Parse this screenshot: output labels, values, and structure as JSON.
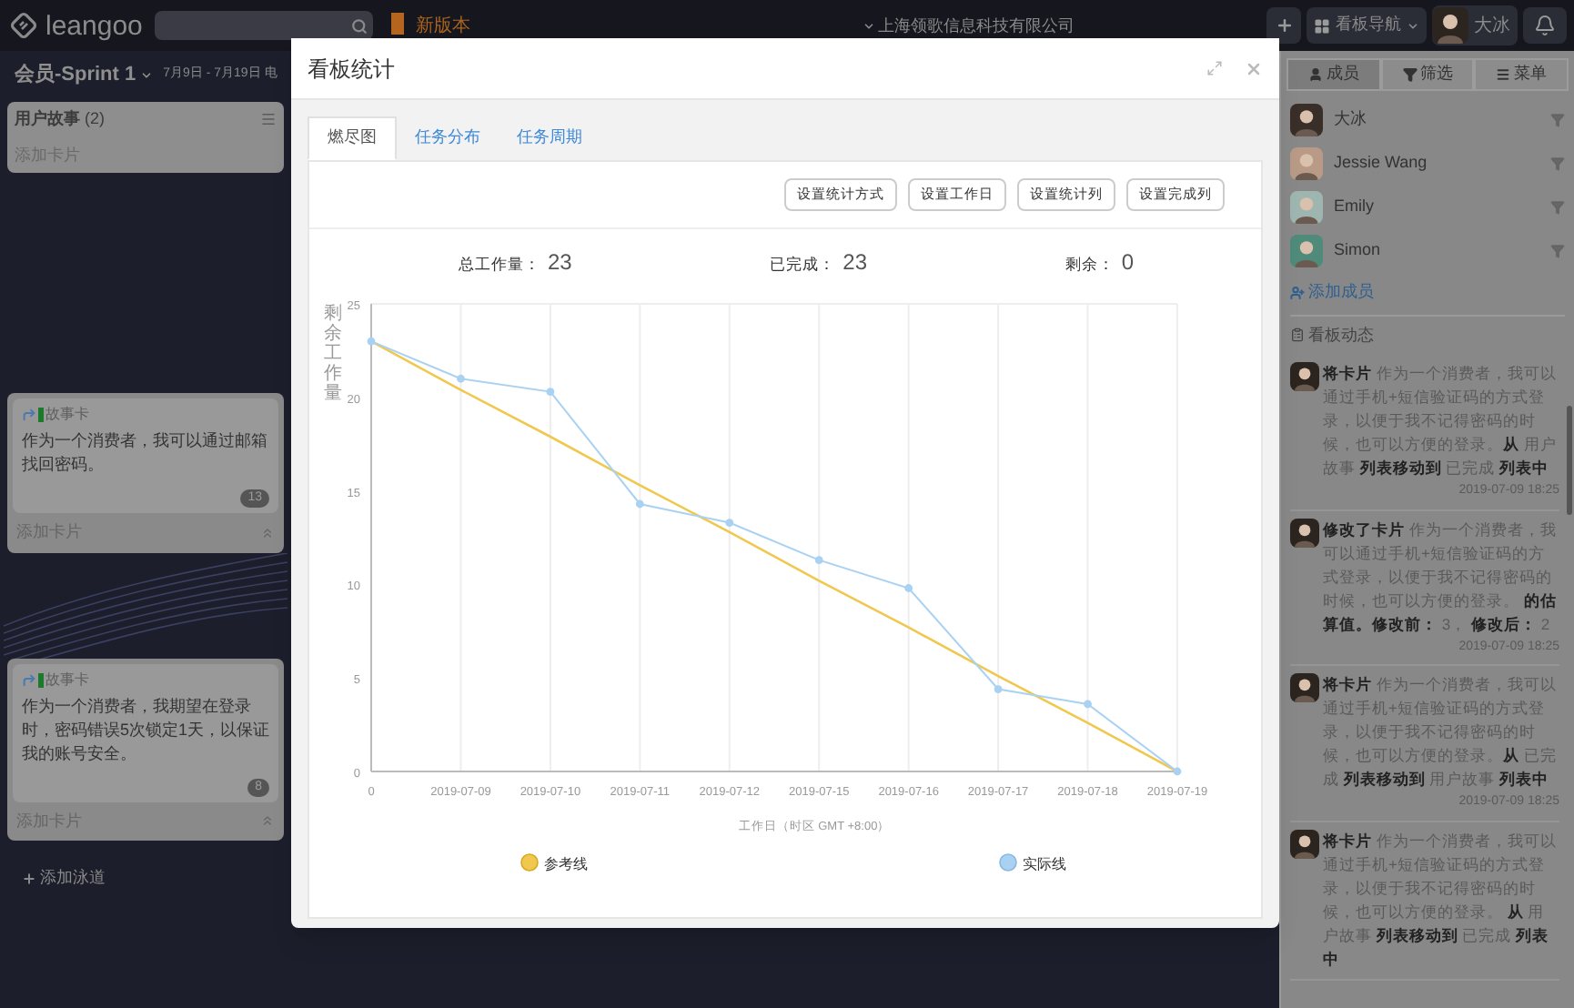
{
  "top_bar": {
    "logo": "leangoo",
    "new_version": "新版本",
    "company": "上海领歌信息科技有限公司",
    "nav_label": "看板导航",
    "user_name": "大冰"
  },
  "board": {
    "title": "会员-Sprint 1",
    "dates": "7月9日 - 7月19日 电",
    "list": {
      "name": "用户故事",
      "count": "(2)",
      "add_card": "添加卡片"
    },
    "lanes": [
      {
        "card": {
          "type": "故事卡",
          "text": "作为一个消费者，我可以通过邮箱找回密码。",
          "estimate": "13"
        },
        "add_card": "添加卡片"
      },
      {
        "card": {
          "type": "故事卡",
          "text": "作为一个消费者，我期望在登录时，密码错误5次锁定1天，以保证我的账号安全。",
          "estimate": "8"
        },
        "add_card": "添加卡片"
      }
    ],
    "add_lane": "添加泳道"
  },
  "right_panel": {
    "tabs": [
      {
        "label": "成员",
        "kind": "members",
        "selected": true
      },
      {
        "label": "筛选",
        "kind": "filter",
        "selected": false
      },
      {
        "label": "菜单",
        "kind": "menu",
        "selected": false
      }
    ],
    "members": [
      {
        "name": "大冰",
        "color": "#3a2e28"
      },
      {
        "name": "Jessie Wang",
        "color": "#b89a86"
      },
      {
        "name": "Emily",
        "color": "#9fb6b0"
      },
      {
        "name": "Simon",
        "color": "#4f8a7a"
      }
    ],
    "add_member": "添加成员",
    "activity_title": "看板动态",
    "activities": [
      {
        "text": "**将卡片** 作为一个消费者，我可以通过手机+短信验证码的方式登录，以便于我不记得密码的时候，也可以方便的登录。**从** 用户故事 **列表移动到** 已完成 **列表中**",
        "time": "2019-07-09 18:25"
      },
      {
        "text": "**修改了卡片** 作为一个消费者，我可以通过手机+短信验证码的方式登录，以便于我不记得密码的时候，也可以方便的登录。 **的估算值。修改前：** 3， **修改后：** 2",
        "time": "2019-07-09 18:25"
      },
      {
        "text": "**将卡片** 作为一个消费者，我可以通过手机+短信验证码的方式登录，以便于我不记得密码的时候，也可以方便的登录。**从** 已完成 **列表移动到** 用户故事 **列表中**",
        "time": "2019-07-09 18:25"
      },
      {
        "text": "**将卡片** 作为一个消费者，我可以通过手机+短信验证码的方式登录，以便于我不记得密码的时候，也可以方便的登录。 **从** 用户故事 **列表移动到** 已完成 **列表中**"
      }
    ]
  },
  "modal": {
    "title": "看板统计",
    "tabs": [
      {
        "label": "燃尽图",
        "selected": true
      },
      {
        "label": "任务分布",
        "selected": false
      },
      {
        "label": "任务周期",
        "selected": false
      }
    ],
    "buttons": [
      "设置统计方式",
      "设置工作日",
      "设置统计列",
      "设置完成列"
    ],
    "stats": [
      {
        "label": "总工作量：",
        "value": "23"
      },
      {
        "label": "已完成：",
        "value": "23"
      },
      {
        "label": "剩余：",
        "value": "0"
      }
    ],
    "chart_data": {
      "type": "line",
      "xlabel": "工作日（时区 GMT +8:00）",
      "ylabel": "剩余工作量",
      "grid": true,
      "legend": "bottom",
      "categories": [
        "0",
        "2019-07-09",
        "2019-07-10",
        "2019-07-11",
        "2019-07-12",
        "2019-07-15",
        "2019-07-16",
        "2019-07-17",
        "2019-07-18",
        "2019-07-19"
      ],
      "ylim": [
        0,
        25
      ],
      "yticks": [
        0,
        5,
        10,
        15,
        20,
        25
      ],
      "series": [
        {
          "name": "参考线",
          "color": "#f0c850",
          "values": [
            23,
            20.4,
            17.9,
            15.3,
            12.8,
            10.2,
            7.7,
            5.1,
            2.6,
            0
          ]
        },
        {
          "name": "实际线",
          "color": "#a9d1f2",
          "marker": "circle",
          "values": [
            23,
            21,
            20.3,
            14.3,
            13.3,
            11.3,
            9.8,
            4.4,
            3.6,
            0
          ]
        }
      ]
    }
  }
}
